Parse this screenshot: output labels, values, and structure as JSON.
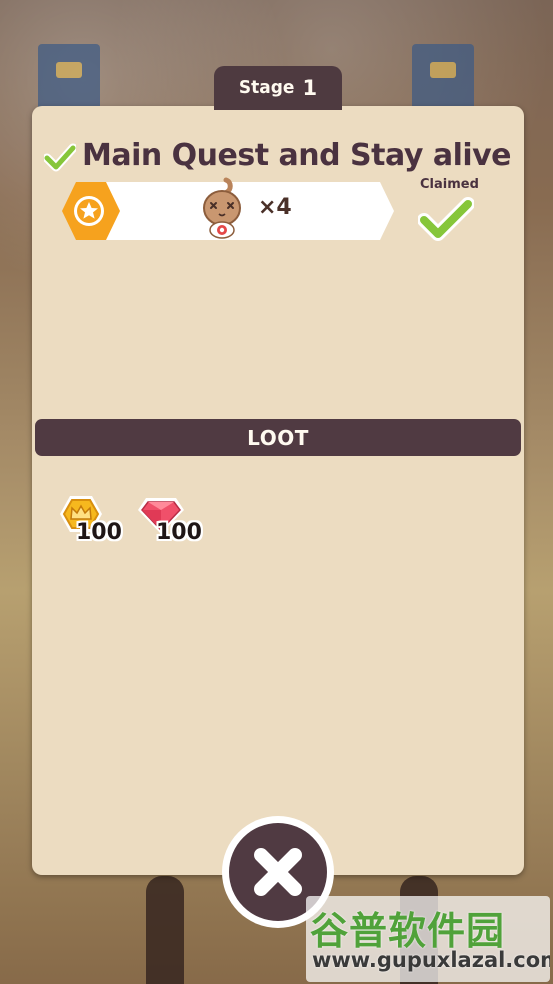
{
  "stage": {
    "label": "Stage",
    "number": "1"
  },
  "quest": {
    "title": "Main Quest and Stay alive",
    "status_label": "Claimed",
    "reward_icon": "star-hexagon-icon",
    "target_icon": "onion-dummy-enemy-icon",
    "target_count": "×4",
    "completed": true
  },
  "loot": {
    "heading": "LOOT",
    "items": [
      {
        "icon": "crown-coin-icon",
        "amount": "100"
      },
      {
        "icon": "red-gem-icon",
        "amount": "100"
      }
    ]
  },
  "close": {
    "icon": "close-x-icon"
  },
  "watermark": {
    "logo": "谷普软件园",
    "url": "www.gupuxlazal.com"
  },
  "colors": {
    "card": "#ecdcc1",
    "dark_panel": "#503a42",
    "text_dark": "#4a3240",
    "check_green": "#86c63a",
    "accent_orange": "#f6a21e",
    "gem_red": "#f0506a"
  }
}
